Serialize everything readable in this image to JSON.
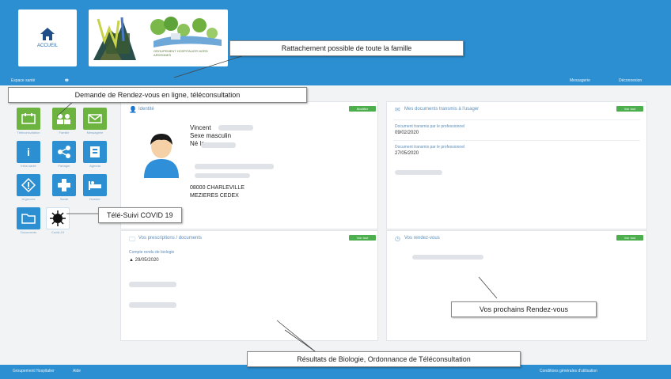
{
  "header": {
    "home_label": "ACCUEIL",
    "logo_text": "GROUPEMENT HOSPITALIER NORD ARDENNES"
  },
  "subbar": {
    "left": "Espace santé",
    "right_a": "Messagerie",
    "right_b": "Déconnexion"
  },
  "panels": {
    "patient": {
      "title": "Identité",
      "badge": "Modifier",
      "name": "Vincent",
      "sex": "Sexe masculin",
      "born": "Né le",
      "city": "08000 CHARLEVILLE",
      "cedex": "MEZIERES CEDEX"
    },
    "documents": {
      "title": "Mes documents transmis à l'usager",
      "badge": "Voir tout",
      "item1_label": "Document transmis par le professionnel",
      "item1_date": "09/02/2020",
      "item2_label": "Document transmis par le professionnel",
      "item2_date": "27/05/2020"
    },
    "results": {
      "title": "Vos prescriptions / documents",
      "badge": "Voir tout",
      "item_label": "Compte rendu de biologie",
      "item_date": "29/05/2020"
    },
    "appointments": {
      "title": "Vos rendez-vous",
      "badge": "Voir tout"
    }
  },
  "sidebar": {
    "apps": [
      "Téléconsultation",
      "Famille",
      "Messagerie",
      "Infos santé",
      "Partager",
      "Agenda",
      "Urgences",
      "Santé",
      "Dossier",
      "Documents",
      "Covid-19"
    ]
  },
  "callouts": {
    "family": "Rattachement possible de toute la famille",
    "appointment": "Demande de Rendez-vous en ligne, téléconsultation",
    "covid": "Télé-Suivi COVID 19",
    "next_rdv": "Vos prochains Rendez-vous",
    "results": "Résultats de Biologie, Ordonnance de Téléconsultation"
  },
  "footer": {
    "left": "Groupement Hospitalier",
    "left2": "Aide",
    "right": "Conditions générales d'utilisation"
  }
}
